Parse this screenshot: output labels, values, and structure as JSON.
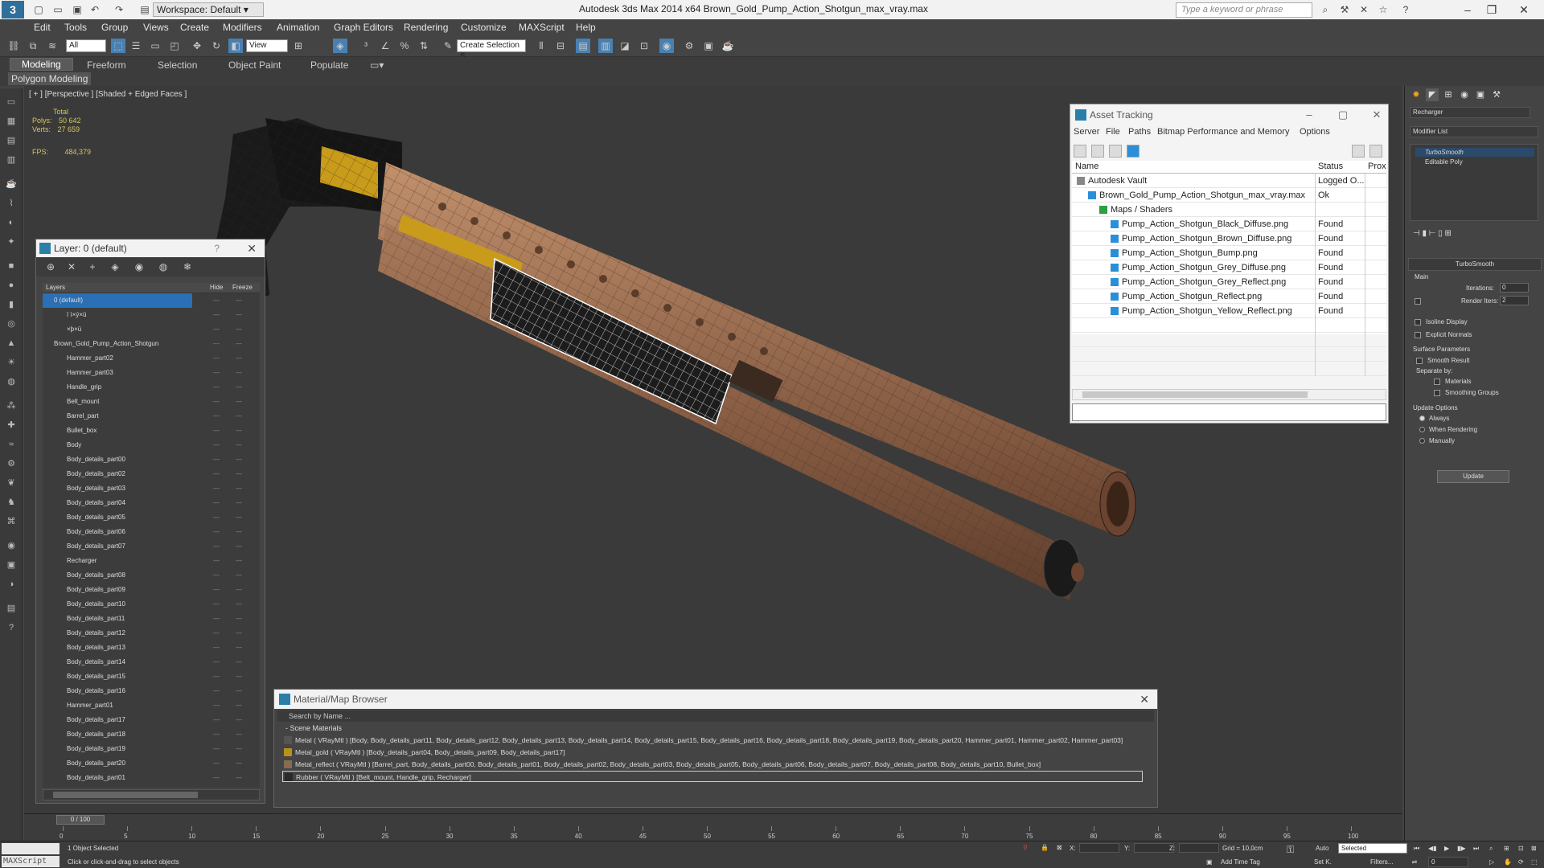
{
  "app": {
    "title": "Autodesk 3ds Max  2014 x64     Brown_Gold_Pump_Action_Shotgun_max_vray.max",
    "workspace": "Workspace: Default",
    "search_placeholder": "Type a keyword or phrase"
  },
  "menu": [
    "Edit",
    "Tools",
    "Group",
    "Views",
    "Create",
    "Modifiers",
    "Animation",
    "Graph Editors",
    "Rendering",
    "Customize",
    "MAXScript",
    "Help"
  ],
  "toolbar": {
    "selection_filter": "All",
    "ref_coord": "View",
    "named_sel": "Create Selection S"
  },
  "ribbon": {
    "tabs": [
      "Modeling",
      "Freeform",
      "Selection",
      "Object Paint",
      "Populate"
    ],
    "active": "Modeling",
    "sub": "Polygon Modeling"
  },
  "viewport": {
    "label": "[ + ] [Perspective ] [Shaded + Edged Faces ]",
    "stats_header": "Total",
    "polys_label": "Polys:",
    "polys_value": "50 642",
    "verts_label": "Verts:",
    "verts_value": "27 659",
    "fps_label": "FPS:",
    "fps_value": "484,379"
  },
  "layer_explorer": {
    "title": "Layer: 0 (default)",
    "help": "?",
    "col_layers": "Layers",
    "col_hide": "Hide",
    "col_freeze": "Freeze",
    "rows": [
      {
        "name": "0 (default)",
        "level": 0,
        "selected": true
      },
      {
        "name": "ï ì×ý×ü",
        "level": 1
      },
      {
        "name": "×þ×ü",
        "level": 1
      },
      {
        "name": "Brown_Gold_Pump_Action_Shotgun",
        "level": 0
      },
      {
        "name": "Hammer_part02",
        "level": 1
      },
      {
        "name": "Hammer_part03",
        "level": 1
      },
      {
        "name": "Handle_grip",
        "level": 1
      },
      {
        "name": "Belt_mount",
        "level": 1
      },
      {
        "name": "Barrel_part",
        "level": 1
      },
      {
        "name": "Bullet_box",
        "level": 1
      },
      {
        "name": "Body",
        "level": 1
      },
      {
        "name": "Body_details_part00",
        "level": 1
      },
      {
        "name": "Body_details_part02",
        "level": 1
      },
      {
        "name": "Body_details_part03",
        "level": 1
      },
      {
        "name": "Body_details_part04",
        "level": 1
      },
      {
        "name": "Body_details_part05",
        "level": 1
      },
      {
        "name": "Body_details_part06",
        "level": 1
      },
      {
        "name": "Body_details_part07",
        "level": 1
      },
      {
        "name": "Recharger",
        "level": 1
      },
      {
        "name": "Body_details_part08",
        "level": 1
      },
      {
        "name": "Body_details_part09",
        "level": 1
      },
      {
        "name": "Body_details_part10",
        "level": 1
      },
      {
        "name": "Body_details_part11",
        "level": 1
      },
      {
        "name": "Body_details_part12",
        "level": 1
      },
      {
        "name": "Body_details_part13",
        "level": 1
      },
      {
        "name": "Body_details_part14",
        "level": 1
      },
      {
        "name": "Body_details_part15",
        "level": 1
      },
      {
        "name": "Body_details_part16",
        "level": 1
      },
      {
        "name": "Hammer_part01",
        "level": 1
      },
      {
        "name": "Body_details_part17",
        "level": 1
      },
      {
        "name": "Body_details_part18",
        "level": 1
      },
      {
        "name": "Body_details_part19",
        "level": 1
      },
      {
        "name": "Body_details_part20",
        "level": 1
      },
      {
        "name": "Body_details_part01",
        "level": 1
      }
    ]
  },
  "asset_tracking": {
    "title": "Asset Tracking",
    "menu": [
      "Server",
      "File",
      "Paths",
      "Bitmap Performance and Memory",
      "Options"
    ],
    "col_name": "Name",
    "col_status": "Status",
    "col_proxy": "Prox",
    "rows": [
      {
        "name": "Autodesk Vault",
        "status": "Logged O...",
        "indent": 0,
        "type": "vault"
      },
      {
        "name": "Brown_Gold_Pump_Action_Shotgun_max_vray.max",
        "status": "Ok",
        "indent": 1,
        "type": "file"
      },
      {
        "name": "Maps / Shaders",
        "status": "",
        "indent": 2,
        "type": "folder"
      },
      {
        "name": "Pump_Action_Shotgun_Black_Diffuse.png",
        "status": "Found",
        "indent": 3,
        "type": "map"
      },
      {
        "name": "Pump_Action_Shotgun_Brown_Diffuse.png",
        "status": "Found",
        "indent": 3,
        "type": "map"
      },
      {
        "name": "Pump_Action_Shotgun_Bump.png",
        "status": "Found",
        "indent": 3,
        "type": "map"
      },
      {
        "name": "Pump_Action_Shotgun_Grey_Diffuse.png",
        "status": "Found",
        "indent": 3,
        "type": "map"
      },
      {
        "name": "Pump_Action_Shotgun_Grey_Reflect.png",
        "status": "Found",
        "indent": 3,
        "type": "map"
      },
      {
        "name": "Pump_Action_Shotgun_Reflect.png",
        "status": "Found",
        "indent": 3,
        "type": "map"
      },
      {
        "name": "Pump_Action_Shotgun_Yellow_Reflect.png",
        "status": "Found",
        "indent": 3,
        "type": "map"
      }
    ]
  },
  "material_browser": {
    "title": "Material/Map Browser",
    "search": "Search by Name ...",
    "section": "- Scene Materials",
    "rows": [
      {
        "text": "Metal ( VRayMtl ) [Body, Body_details_part11, Body_details_part12, Body_details_part13, Body_details_part14, Body_details_part15, Body_details_part16, Body_details_part18, Body_details_part19, Body_details_part20, Hammer_part01, Hammer_part02, Hammer_part03]",
        "swatch": "#555555"
      },
      {
        "text": "Metal_gold ( VRayMtl ) [Body_details_part04, Body_details_part09, Body_details_part17]",
        "swatch": "#b8901a"
      },
      {
        "text": "Metal_reflect ( VRayMtl ) [Barrel_part, Body_details_part00, Body_details_part01, Body_details_part02, Body_details_part03, Body_details_part05, Body_details_part06, Body_details_part07, Body_details_part08, Body_details_part10, Bullet_box]",
        "swatch": "#8a6a50"
      },
      {
        "text": "Rubber ( VRayMtl ) [Belt_mount, Handle_grip, Recharger]",
        "swatch": "#2a2a2a"
      }
    ]
  },
  "command_panel": {
    "object_name": "Recharger",
    "modifier_list": "Modifier List",
    "stack": [
      "TurboSmooth",
      "Editable Poly"
    ],
    "rollout": "TurboSmooth",
    "main": "Main",
    "iterations_label": "Iterations:",
    "iterations_value": "0",
    "render_iters_label": "Render Iters:",
    "render_iters_value": "2",
    "isoline": "Isoline Display",
    "explicit": "Explicit Normals",
    "surface": "Surface Parameters",
    "smooth_result": "Smooth Result",
    "separate_by": "Separate by:",
    "materials": "Materials",
    "smoothing_groups": "Smoothing Groups",
    "update_options": "Update Options",
    "always": "Always",
    "when_rendering": "When Rendering",
    "manually": "Manually",
    "update": "Update"
  },
  "timeline": {
    "frame": "0 / 100",
    "ticks": [
      "0",
      "5",
      "10",
      "15",
      "20",
      "25",
      "30",
      "35",
      "40",
      "45",
      "50",
      "55",
      "60",
      "65",
      "70",
      "75",
      "80",
      "85",
      "90",
      "95",
      "100"
    ]
  },
  "status": {
    "maxscript": "MAXScript",
    "selected": "1 Object Selected",
    "prompt": "Click or click-and-drag to select objects",
    "x_label": "X:",
    "y_label": "Y:",
    "z_label": "Z:",
    "grid": "Grid = 10,0cm",
    "add_time_tag": "Add Time Tag",
    "auto": "Auto",
    "set_key": "Set K.",
    "selected_mode": "Selected",
    "filters": "Filters...",
    "frame_field": "0"
  }
}
